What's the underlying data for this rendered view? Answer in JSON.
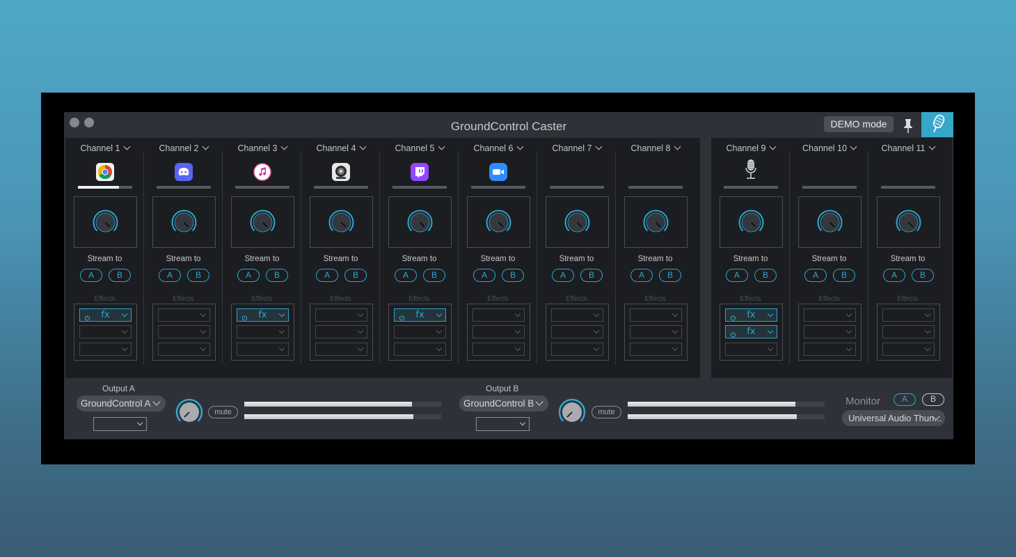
{
  "window": {
    "title": "GroundControl Caster",
    "demo_label": "DEMO mode"
  },
  "channel_strings": {
    "stream_to": "Stream to",
    "effects": "Effects",
    "btn_a": "A",
    "btn_b": "B",
    "fx": "fx"
  },
  "channels": [
    {
      "name": "Channel 1",
      "app_icon": "chrome-icon",
      "level": 0.75,
      "effects_active": [
        true,
        false,
        false
      ]
    },
    {
      "name": "Channel 2",
      "app_icon": "discord-icon",
      "level": 0,
      "effects_active": [
        false,
        false,
        false
      ]
    },
    {
      "name": "Channel 3",
      "app_icon": "itunes-icon",
      "level": 0,
      "effects_active": [
        true,
        false,
        false
      ]
    },
    {
      "name": "Channel 4",
      "app_icon": "audio-app-icon",
      "level": 0,
      "effects_active": [
        false,
        false,
        false
      ]
    },
    {
      "name": "Channel 5",
      "app_icon": "twitch-icon",
      "level": 0,
      "effects_active": [
        true,
        false,
        false
      ]
    },
    {
      "name": "Channel 6",
      "app_icon": "zoom-icon",
      "level": 0,
      "effects_active": [
        false,
        false,
        false
      ]
    },
    {
      "name": "Channel 7",
      "app_icon": "",
      "level": 0,
      "effects_active": [
        false,
        false,
        false
      ]
    },
    {
      "name": "Channel 8",
      "app_icon": "",
      "level": 0,
      "effects_active": [
        false,
        false,
        false
      ]
    },
    {
      "name": "Channel 9",
      "app_icon": "microphone-icon",
      "level": 0,
      "effects_active": [
        true,
        true,
        false
      ]
    },
    {
      "name": "Channel 10",
      "app_icon": "",
      "level": 0,
      "effects_active": [
        false,
        false,
        false
      ]
    },
    {
      "name": "Channel 11",
      "app_icon": "",
      "level": 0,
      "effects_active": [
        false,
        false,
        false
      ]
    }
  ],
  "output_a": {
    "label": "Output A",
    "device": "GroundControl A",
    "mute_label": "mute",
    "levels": [
      0.85,
      0.86
    ]
  },
  "output_b": {
    "label": "Output B",
    "device": "GroundControl B",
    "mute_label": "mute",
    "levels": [
      0.85,
      0.86
    ]
  },
  "monitor": {
    "label": "Monitor",
    "btn_a": "A",
    "btn_b": "B",
    "device": "Universal Audio Thun..."
  },
  "colors": {
    "accent": "#2fa6cf",
    "panel": "#1b1d21",
    "window": "#2e3238"
  }
}
